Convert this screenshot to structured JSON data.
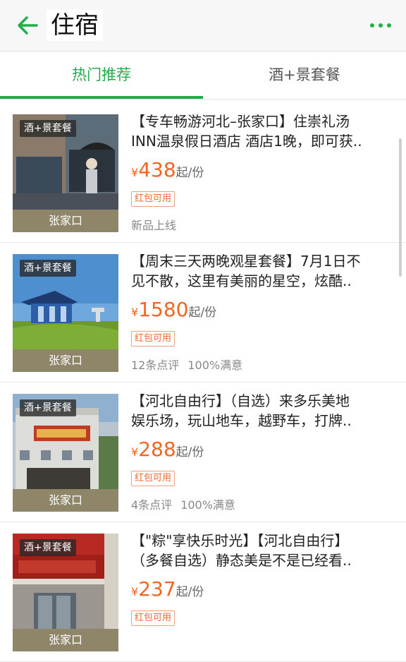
{
  "header": {
    "title": "住宿",
    "back_icon": "arrow-left-icon",
    "more_icon": "more-dots-icon",
    "accent": "#22ad4a"
  },
  "tabs": [
    {
      "label": "热门推荐",
      "active": true
    },
    {
      "label": "酒+景套餐",
      "active": false
    }
  ],
  "items": [
    {
      "badge": "酒+景套餐",
      "city": "张家口",
      "title_line1": "【专车畅游河北–张家口】住崇礼汤",
      "title_line2": "INN温泉假日酒店 酒店1晚，即可获..",
      "currency": "¥",
      "price": "438",
      "unit": "起/份",
      "tag": "红包可用",
      "meta1": "新品上线",
      "meta2": ""
    },
    {
      "badge": "酒+景套餐",
      "city": "张家口",
      "title_line1": "【周末三天两晚观星套餐】7月1日不",
      "title_line2": "见不散，这里有美丽的星空，炫酷..",
      "currency": "¥",
      "price": "1580",
      "unit": "起/份",
      "tag": "红包可用",
      "meta1": "12条点评",
      "meta2": "100%满意"
    },
    {
      "badge": "酒+景套餐",
      "city": "张家口",
      "title_line1": "【河北自由行】（自选）来多乐美地",
      "title_line2": "娱乐场，玩山地车，越野车，打牌..",
      "currency": "¥",
      "price": "288",
      "unit": "起/份",
      "tag": "红包可用",
      "meta1": "4条点评",
      "meta2": "100%满意"
    },
    {
      "badge": "酒+景套餐",
      "city": "张家口",
      "title_line1": "【\"粽\"享快乐时光】【河北自由行】",
      "title_line2": "（多餐自选）静态美是不是已经看..",
      "currency": "¥",
      "price": "237",
      "unit": "起/份",
      "tag": "红包可用",
      "meta1": "",
      "meta2": ""
    }
  ]
}
